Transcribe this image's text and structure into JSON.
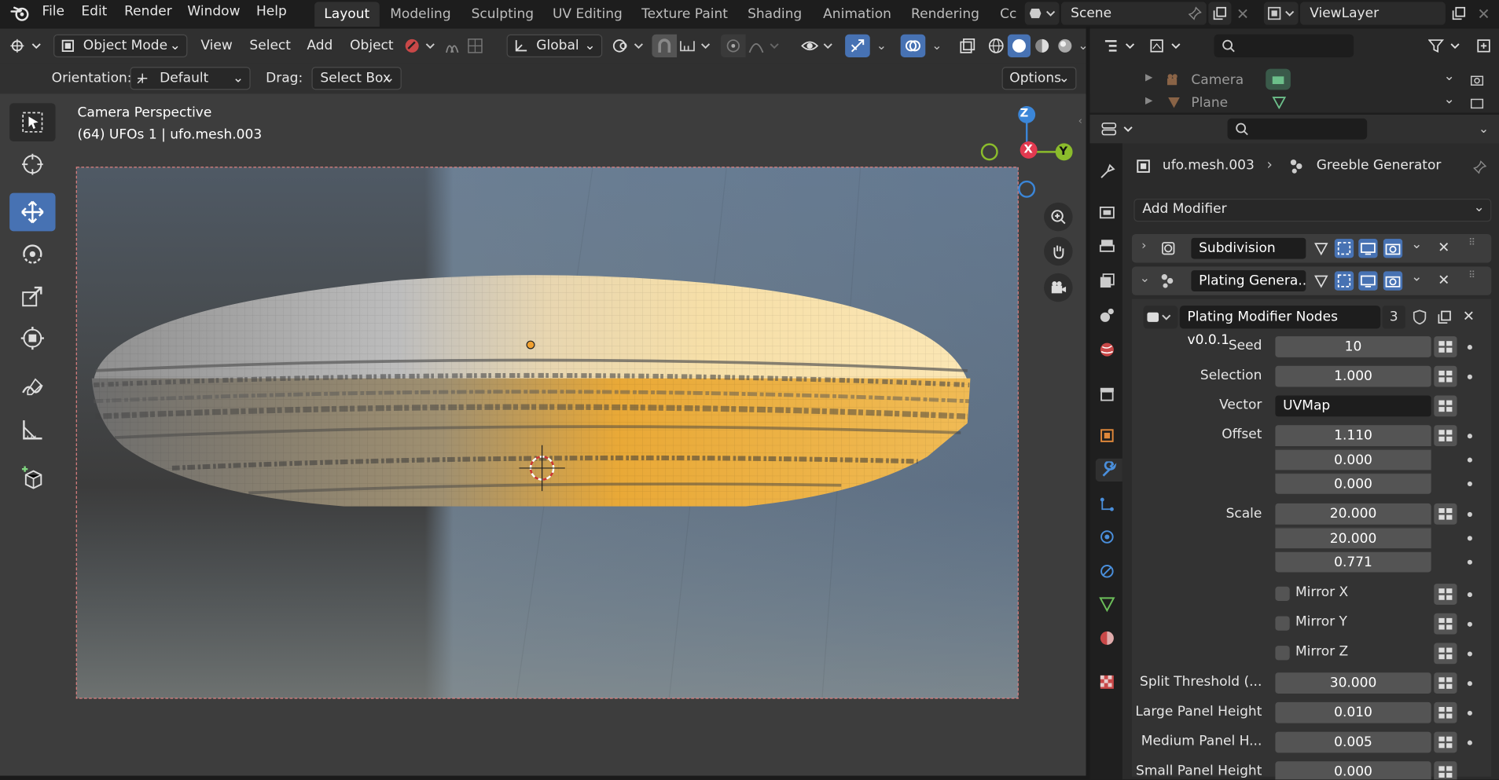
{
  "menu": [
    "File",
    "Edit",
    "Render",
    "Window",
    "Help"
  ],
  "workspaces": [
    "Layout",
    "Modeling",
    "Sculpting",
    "UV Editing",
    "Texture Paint",
    "Shading",
    "Animation",
    "Rendering",
    "Cc"
  ],
  "active_workspace": "Layout",
  "scene": "Scene",
  "view_layer": "ViewLayer",
  "header": {
    "mode": "Object Mode",
    "view": "View",
    "select": "Select",
    "add": "Add",
    "object": "Object",
    "transform_orientation": "Global"
  },
  "tool_settings": {
    "orientation_label": "Orientation:",
    "orientation_value": "Default",
    "drag_label": "Drag:",
    "drag_value": "Select Box",
    "options": "Options"
  },
  "viewport": {
    "view_name": "Camera Perspective",
    "object_info": "(64) UFOs 1 | ufo.mesh.003",
    "axes": {
      "z": "Z",
      "x": "X",
      "y": "Y"
    }
  },
  "outliner": {
    "items": [
      {
        "label": "Camera"
      },
      {
        "label": "Plane"
      }
    ]
  },
  "properties": {
    "breadcrumb_object": "ufo.mesh.003",
    "breadcrumb_modifier": "Greeble Generator",
    "add_modifier": "Add Modifier",
    "modifiers": [
      {
        "name": "Subdivision",
        "expanded": false
      },
      {
        "name": "Plating Genera...",
        "expanded": true
      }
    ],
    "node_group": {
      "name": "Plating Modifier Nodes v0.0.1",
      "users": "3"
    },
    "fields": {
      "seed": {
        "label": "Seed",
        "value": "10"
      },
      "selection": {
        "label": "Selection",
        "value": "1.000"
      },
      "vector": {
        "label": "Vector",
        "value": "UVMap"
      },
      "offset": {
        "label": "Offset",
        "values": [
          "1.110",
          "0.000",
          "0.000"
        ]
      },
      "scale": {
        "label": "Scale",
        "values": [
          "20.000",
          "20.000",
          "0.771"
        ]
      },
      "mirror_x": "Mirror X",
      "mirror_y": "Mirror Y",
      "mirror_z": "Mirror Z",
      "split_threshold": {
        "label": "Split Threshold (...",
        "value": "30.000"
      },
      "large_panel_height": {
        "label": "Large Panel Height",
        "value": "0.010"
      },
      "medium_panel_height": {
        "label": "Medium Panel H...",
        "value": "0.005"
      },
      "small_panel_height": {
        "label": "Small Panel Height",
        "value": "0.000"
      }
    }
  },
  "colors": {
    "accent": "#4772b3",
    "axis_x": "#e23a50",
    "axis_y": "#8bbc2c",
    "axis_z": "#3b86d8",
    "wrench_active": "#4a8fdc"
  }
}
